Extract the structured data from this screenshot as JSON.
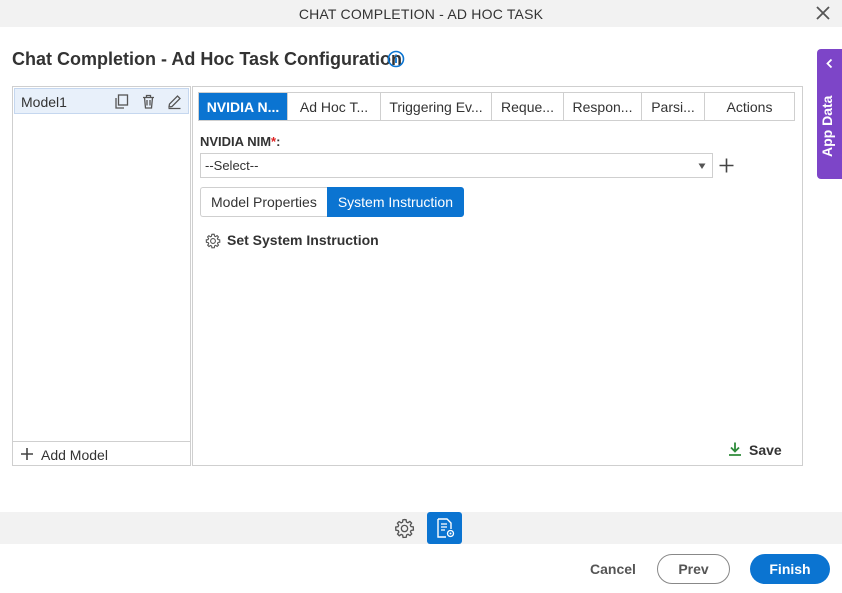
{
  "window": {
    "title": "CHAT COMPLETION - AD HOC TASK",
    "close_icon": "close-icon"
  },
  "page": {
    "title": "Chat Completion - Ad Hoc Task Configuration",
    "info_icon": "info-icon"
  },
  "app_data": {
    "label": "App Data",
    "icon": "chevron-left-icon"
  },
  "models": {
    "items": [
      {
        "name": "Model1"
      }
    ],
    "item_icons": [
      "copy-icon",
      "delete-icon",
      "edit-icon"
    ],
    "add_label": "Add Model"
  },
  "tabs": [
    {
      "label": "NVIDIA N...",
      "active": true
    },
    {
      "label": "Ad Hoc T...",
      "active": false
    },
    {
      "label": "Triggering Ev...",
      "active": false
    },
    {
      "label": "Reque...",
      "active": false
    },
    {
      "label": "Respon...",
      "active": false
    },
    {
      "label": "Parsi...",
      "active": false
    },
    {
      "label": "Actions",
      "active": false
    }
  ],
  "nim": {
    "label": "NVIDIA NIM",
    "required_mark": "*",
    "label_suffix": ":",
    "selected": "--Select--"
  },
  "subtabs": [
    {
      "label": "Model Properties",
      "active": false
    },
    {
      "label": "System Instruction",
      "active": true
    }
  ],
  "system_instruction": {
    "action_label": "Set System Instruction"
  },
  "save": {
    "label": "Save"
  },
  "footer": {
    "cancel": "Cancel",
    "prev": "Prev",
    "finish": "Finish"
  },
  "colors": {
    "accent": "#0b74d1",
    "app_data": "#7d45c8",
    "save_icon": "#2e8b3a"
  }
}
